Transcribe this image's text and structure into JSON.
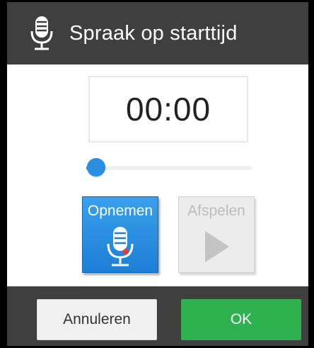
{
  "dialog": {
    "title": "Spraak op starttijd",
    "title_icon": "microphone-icon"
  },
  "timer": {
    "value": "00:00"
  },
  "progress": {
    "position_fraction": 0.0,
    "accent_color": "#2b8fe0"
  },
  "actions": {
    "record_label": "Opnemen",
    "record_icon": "microphone-icon",
    "record_color": "#1e88d8",
    "play_label": "Afspelen",
    "play_icon": "play-icon",
    "play_enabled": false
  },
  "footer": {
    "cancel_label": "Annuleren",
    "ok_label": "OK",
    "ok_color": "#2eb24f"
  }
}
